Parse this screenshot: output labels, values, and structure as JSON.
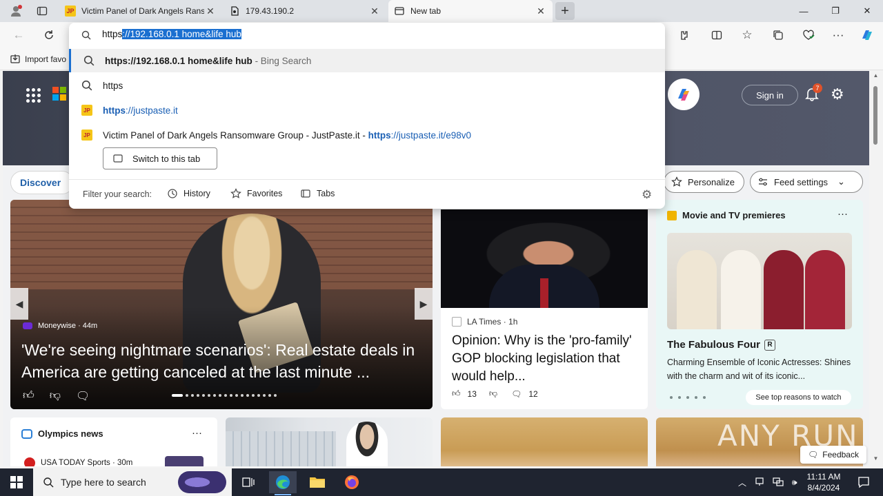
{
  "tabs": [
    {
      "title": "Victim Panel of Dark Angels Ransomware Group - JustPaste.it",
      "favicon": "JP"
    },
    {
      "title": "179.43.190.2"
    },
    {
      "title": "New tab"
    }
  ],
  "favorites_bar": {
    "import_label": "Import favo"
  },
  "omnibox": {
    "typed": "https",
    "completion": "://192.168.0.1 home&life hub",
    "suggestions": [
      {
        "bold": "https://192.168.0.1 home&life hub",
        "suffix": " - Bing Search"
      },
      {
        "text": "https"
      },
      {
        "link": "https://justpaste.it",
        "link_bold": "https",
        "link_rest": "://justpaste.it"
      },
      {
        "text": "Victim Panel of Dark Angels Ransomware Group - JustPaste.it",
        "sep": " - ",
        "link_bold": "https",
        "link_rest": "://justpaste.it/e98v0"
      }
    ],
    "switch_tab_label": "Switch to this tab",
    "filter_label": "Filter your search:",
    "filters": [
      "History",
      "Favorites",
      "Tabs"
    ]
  },
  "hero": {
    "sign_in": "Sign in",
    "notifications": "7"
  },
  "feed": {
    "discover": "Discover",
    "personalize": "Personalize",
    "feed_settings": "Feed settings"
  },
  "cards": {
    "main": {
      "source": "Moneywise · 44m",
      "headline": "'We're seeing nightmare scenarios': Real estate deals in America are getting canceled at the last minute ..."
    },
    "news": {
      "source": "LA Times · 1h",
      "headline": "Opinion: Why is the 'pro-family' GOP blocking legislation that would help...",
      "likes": "13",
      "comments": "12"
    },
    "movie": {
      "header": "Movie and TV premieres",
      "title": "The Fabulous Four",
      "rating": "R",
      "desc": "Charming Ensemble of Iconic Actresses: Shines with the charm and wit of its iconic...",
      "reasons": "See top reasons to watch"
    },
    "olympics": {
      "header": "Olympics news",
      "line": "USA TODAY Sports · 30m"
    }
  },
  "feedback": "Feedback",
  "watermark": "ANY RUN",
  "taskbar": {
    "search_placeholder": "Type here to search",
    "time": "11:11 AM",
    "date": "8/4/2024"
  },
  "colors": {
    "accent": "#1a6fd0",
    "taskbar": "#1f2430",
    "link": "#1a5fb4"
  }
}
